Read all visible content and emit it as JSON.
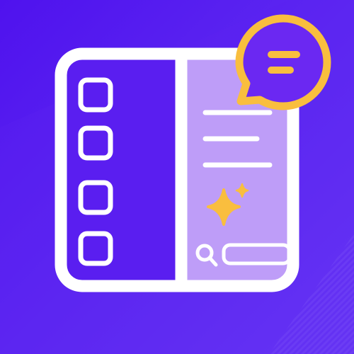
{
  "app_icon": {
    "icons": {
      "window": "split-window-icon",
      "checkbox": "checkbox-icon",
      "sparkle": "sparkle-icon",
      "search": "search-icon",
      "search_field": "search-field",
      "chat": "chat-bubble-icon"
    },
    "left_panel": {
      "checkbox_count": 4
    },
    "right_panel": {
      "text_line_count": 3
    }
  },
  "colors": {
    "background_start": "#5416F0",
    "background_end": "#6A3DF5",
    "left_panel_fill": "#5A1EF0",
    "right_panel_fill": "#BE9DF8",
    "outline": "#FFFFFF",
    "accent_yellow": "#F9BE3E",
    "chat_fill": "#6B28F2"
  }
}
